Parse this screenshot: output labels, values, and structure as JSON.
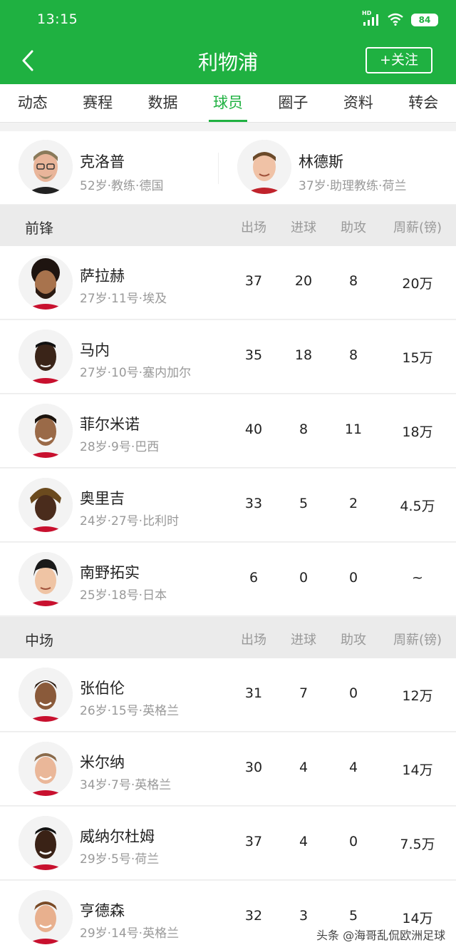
{
  "status": {
    "time": "13:15",
    "battery": "84",
    "hd": "HD"
  },
  "nav": {
    "title": "利物浦",
    "follow_label": "+关注"
  },
  "tabs": [
    "动态",
    "赛程",
    "数据",
    "球员",
    "圈子",
    "资料",
    "转会"
  ],
  "active_tab": 3,
  "staff": [
    {
      "name": "克洛普",
      "meta": "52岁·教练·德国"
    },
    {
      "name": "林德斯",
      "meta": "37岁·助理教练·荷兰"
    }
  ],
  "columns": {
    "apps": "出场",
    "goals": "进球",
    "assists": "助攻",
    "wage": "周薪(镑)"
  },
  "forwards": {
    "title": "前锋",
    "players": [
      {
        "name": "萨拉赫",
        "meta": "27岁·11号·埃及",
        "apps": "37",
        "goals": "20",
        "assists": "8",
        "wage": "20万"
      },
      {
        "name": "马内",
        "meta": "27岁·10号·塞内加尔",
        "apps": "35",
        "goals": "18",
        "assists": "8",
        "wage": "15万"
      },
      {
        "name": "菲尔米诺",
        "meta": "28岁·9号·巴西",
        "apps": "40",
        "goals": "8",
        "assists": "11",
        "wage": "18万"
      },
      {
        "name": "奥里吉",
        "meta": "24岁·27号·比利时",
        "apps": "33",
        "goals": "5",
        "assists": "2",
        "wage": "4.5万"
      },
      {
        "name": "南野拓实",
        "meta": "25岁·18号·日本",
        "apps": "6",
        "goals": "0",
        "assists": "0",
        "wage": "~"
      }
    ]
  },
  "midfielders": {
    "title": "中场",
    "players": [
      {
        "name": "张伯伦",
        "meta": "26岁·15号·英格兰",
        "apps": "31",
        "goals": "7",
        "assists": "0",
        "wage": "12万"
      },
      {
        "name": "米尔纳",
        "meta": "34岁·7号·英格兰",
        "apps": "30",
        "goals": "4",
        "assists": "4",
        "wage": "14万"
      },
      {
        "name": "威纳尔杜姆",
        "meta": "29岁·5号·荷兰",
        "apps": "37",
        "goals": "4",
        "assists": "0",
        "wage": "7.5万"
      },
      {
        "name": "亨德森",
        "meta": "29岁·14号·英格兰",
        "apps": "32",
        "goals": "3",
        "assists": "5",
        "wage": "14万"
      }
    ]
  },
  "watermark": "头条 @海哥乱侃欧洲足球",
  "colors": {
    "brand_green": "#1fb141",
    "muted_text": "#999999",
    "section_bg": "#ebebeb"
  }
}
